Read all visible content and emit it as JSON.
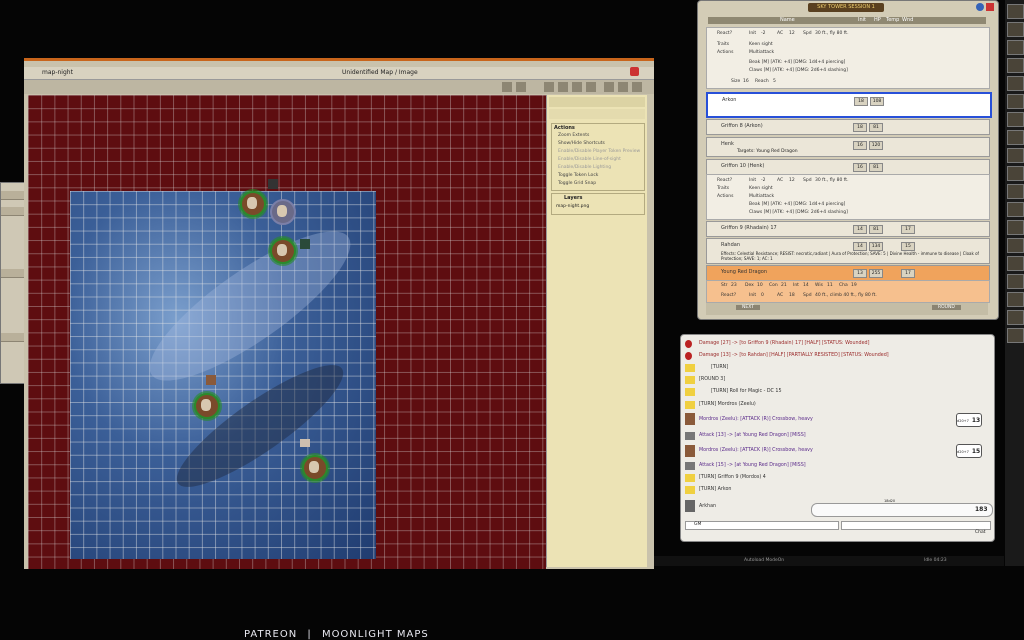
{
  "map_window": {
    "title": "map-night",
    "subtitle": "Unidentified Map / Image",
    "watermark_left": "PATREON",
    "watermark_right": "MOONLIGHT MAPS",
    "actions_header": "Actions",
    "actions": [
      "Zoom Extents",
      "Show/Hide Shortcuts",
      "Enable/Disable Player Token Preview",
      "Enable/Disable Line-of-sight",
      "Enable/Disable Lighting",
      "Toggle Token Lock",
      "Toggle Grid Snap"
    ],
    "layers_header": "Layers",
    "layers": [
      "map-night.png"
    ]
  },
  "combat_tracker": {
    "title": "SKY TOWER SESSION 1",
    "columns": {
      "name": "Name",
      "init": "Init",
      "hp": "HP",
      "temp": "Temp",
      "wnd": "Wnd"
    },
    "rows": [
      {
        "name": "",
        "init": "",
        "hp": "",
        "details": {
          "react_label": "React?",
          "init_label": "Init",
          "init": "-2",
          "ac_label": "AC",
          "ac": "12",
          "spd_label": "Spd",
          "spd": "30 ft., fly 80 ft.",
          "traits": "Traits",
          "traits_val": "Keen sight",
          "actions": "Actions",
          "actions_val": "Multiattack",
          "a1": "Beak [M] [ATK: +4] [DMG: 1d4+4 piercing]",
          "a2": "Claws [M] [ATK: +4] [DMG: 2d6+4 slashing]",
          "size_label": "Size",
          "size": "16",
          "reach_label": "Reach",
          "reach": "5"
        }
      },
      {
        "name": "Arkon",
        "init": "18",
        "hp": "108",
        "active": true
      },
      {
        "name": "Griffon 8 (Arkon)",
        "init": "18",
        "hp": "81"
      },
      {
        "name": "Henk",
        "init": "16",
        "hp": "120",
        "targets": "Targets: Young Red Dragon"
      },
      {
        "name": "Griffon 10 (Henk)",
        "init": "16",
        "hp": "81",
        "details": {
          "react_label": "React?",
          "init_label": "Init",
          "init": "-2",
          "ac_label": "AC",
          "ac": "12",
          "spd_label": "Spd",
          "spd": "30 ft., fly 80 ft.",
          "traits": "Traits",
          "traits_val": "Keen sight",
          "actions": "Actions",
          "actions_val": "Multiattack",
          "a1": "Beak [M] [ATK: +4] [DMG: 1d4+4 piercing]",
          "a2": "Claws [M] [ATK: +4] [DMG: 2d6+4 slashing]"
        }
      },
      {
        "name": "Griffon 9 (Rhadain) 17",
        "init": "14",
        "hp": "81",
        "hp2": "17"
      },
      {
        "name": "Rahdan",
        "init": "14",
        "hp": "134",
        "hp2": "15",
        "effects": "Effects: Celestial Resistance; RESIST: necrotic,radiant | Aura of Protection; SAVE: 5 | Divine Health - immune to disease | Cloak of Protection; SAVE: 1; AC: 1"
      },
      {
        "name": "Young Red Dragon",
        "init": "13",
        "hp": "255",
        "hp2": "17",
        "hostile": true,
        "stats": {
          "str_label": "Str",
          "str": "23",
          "dex_label": "Dex",
          "dex": "10",
          "con_label": "Con",
          "con": "21",
          "int_label": "Int",
          "int": "14",
          "wis_label": "Wis",
          "wis": "11",
          "cha_label": "Cha",
          "cha": "19"
        },
        "details": {
          "react_label": "React?",
          "init_label": "Init",
          "init": "0",
          "ac_label": "AC",
          "ac": "18",
          "spd_label": "Spd",
          "spd": "40 ft., climb 40 ft., fly 80 ft."
        }
      }
    ],
    "footer_left": "NEXT",
    "footer_right": "ROUND"
  },
  "chat": {
    "messages": [
      {
        "type": "dmg",
        "text": "Damage [27] -> [to Griffon 9 (Rhadain) 17] [HALF] [STATUS: Wounded]"
      },
      {
        "type": "dmg",
        "text": "Damage [13] -> [to Rahdan] [HALF] [PARTIALLY RESISTED] [STATUS: Wounded]"
      },
      {
        "type": "note",
        "text": "[TURN]"
      },
      {
        "type": "note",
        "text": "[ROUND 3]"
      },
      {
        "type": "note",
        "text": "[TURN] Roll for Magic - DC 15"
      },
      {
        "type": "note",
        "text": "[TURN] Mordros (Zeelu)"
      },
      {
        "type": "atk",
        "text": "Mordros (Zeelu):  [ATTACK (R)] Crossbow, heavy",
        "roll": "13",
        "roll_label": "d20+7"
      },
      {
        "type": "atk",
        "text": "Attack [13] -> [at Young Red Dragon] [MISS]"
      },
      {
        "type": "atk",
        "text": "Mordros (Zeelu):  [ATTACK (R)] Crossbow, heavy",
        "roll": "15",
        "roll_label": "d20+7"
      },
      {
        "type": "atk",
        "text": "Attack [15] -> [at Young Red Dragon] [MISS]"
      },
      {
        "type": "note",
        "text": "[TURN] Griffon 9 (Mordos) 4"
      },
      {
        "type": "note",
        "text": "[TURN] Arkon"
      },
      {
        "type": "note",
        "text": "Arkhan",
        "roll": "183",
        "roll_label": "18d20"
      }
    ],
    "mode_value": "GM",
    "footer_right": "Chat"
  },
  "status_bar": {
    "left": "Autoload ModeOn",
    "right": "Idle 04:23"
  },
  "colors": {
    "map_red": "#5e0d10",
    "accent": "#c8651b",
    "ct_active": "#2850d8",
    "hostile": "#f0a35c"
  }
}
